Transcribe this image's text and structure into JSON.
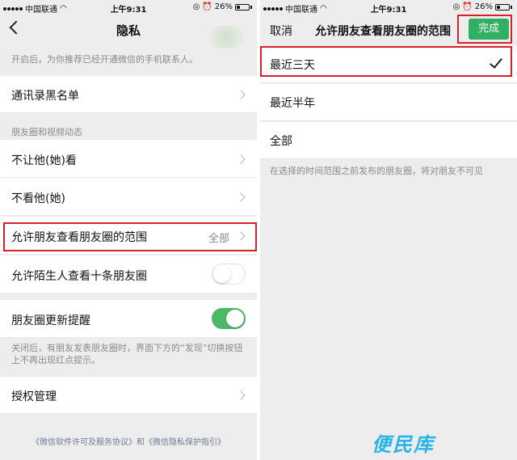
{
  "status": {
    "carrier": "中国联通",
    "time": "上午9:31",
    "battery": "26%",
    "battery_level": 0.26
  },
  "left": {
    "title": "隐私",
    "top_hint": "开启后，为你推荐已经开通微信的手机联系人。",
    "row_blacklist": "通讯录黑名单",
    "section_moments": "朋友圈和视频动态",
    "row_hide_from": "不让他(她)看",
    "row_not_see": "不看他(她)",
    "row_range": "允许朋友查看朋友圈的范围",
    "row_range_value": "全部",
    "row_strangers": "允许陌生人查看十条朋友圈",
    "row_strangers_on": false,
    "row_update": "朋友圈更新提醒",
    "row_update_on": true,
    "update_hint": "关闭后，有朋友发表朋友圈时，界面下方的“发现”切换按钮上不再出现红点提示。",
    "row_auth": "授权管理",
    "footer": "《微信软件许可及服务协议》和《微信隐私保护指引》"
  },
  "right": {
    "cancel": "取消",
    "title": "允许朋友查看朋友圈的范围",
    "done": "完成",
    "options": [
      "最近三天",
      "最近半年",
      "全部"
    ],
    "selected_index": 0,
    "hint": "在选择的时间范围之前发布的朋友圈，将对朋友不可见"
  },
  "watermark": "便民库",
  "colors": {
    "accent_green": "#2fb062",
    "toggle_green": "#4cb86a",
    "highlight_red": "#d81f2a",
    "link_blue": "#6c7c92",
    "watermark_blue": "#28b4ea"
  }
}
